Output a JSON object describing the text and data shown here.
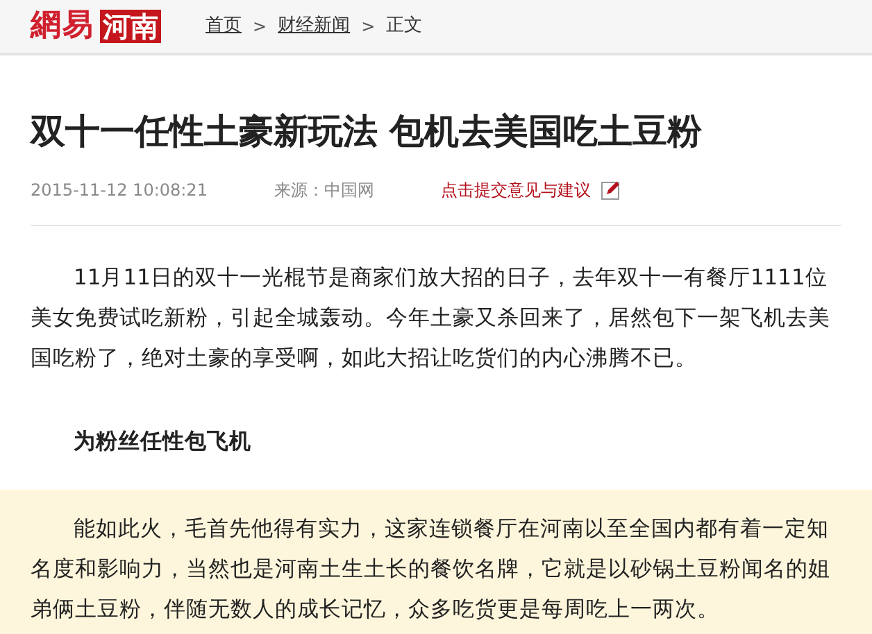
{
  "header": {
    "logo": {
      "brand": "網易",
      "region": "河南"
    },
    "breadcrumb": [
      {
        "label": "首页"
      },
      {
        "label": "财经新闻"
      },
      {
        "label": "正文"
      }
    ],
    "separator": ">"
  },
  "article": {
    "title": "双十一任性土豪新玩法 包机去美国吃土豆粉",
    "datetime": "2015-11-12 10:08:21",
    "source": "来源：中国网",
    "feedback_link": "点击提交意见与建议",
    "blocks": [
      {
        "kind": "paragraph",
        "text": "11月11日的双十一光棍节是商家们放大招的日子，去年双十一有餐厅1111位美女免费试吃新粉，引起全城轰动。今年土豪又杀回来了，居然包下一架飞机去美国吃粉了，绝对土豪的享受啊，如此大招让吃货们的内心沸腾不已。",
        "highlighted": false
      },
      {
        "kind": "heading",
        "text": "为粉丝任性包飞机",
        "highlighted": false
      },
      {
        "kind": "paragraph",
        "text": "能如此火，毛首先他得有实力，这家连锁餐厅在河南以至全国内都有着一定知名度和影响力，当然也是河南土生土长的餐饮名牌，它就是以砂锅土豆粉闻名的姐弟俩土豆粉，伴随无数人的成长记忆，众多吃货更是每周吃上一两次。",
        "highlighted": true
      }
    ]
  }
}
